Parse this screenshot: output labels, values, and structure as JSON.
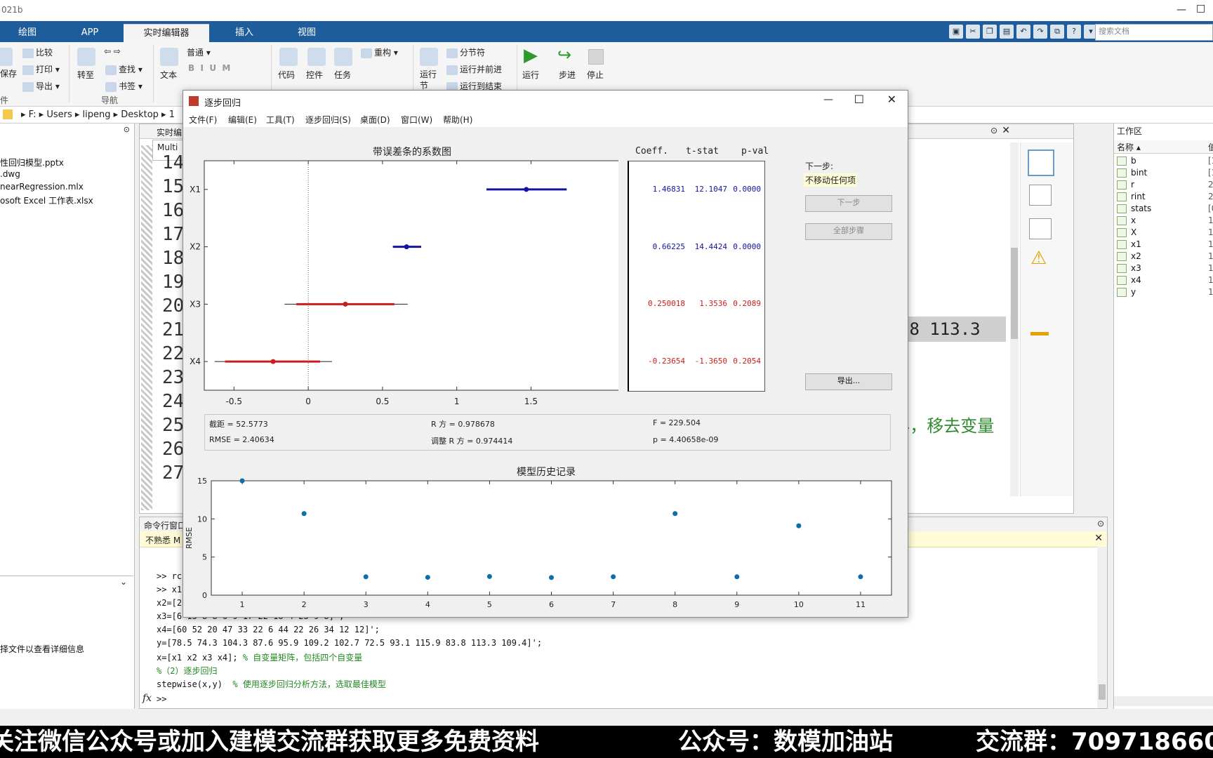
{
  "app": {
    "title": "021b"
  },
  "tabs": [
    {
      "label": "绘图"
    },
    {
      "label": "APP"
    },
    {
      "label": "实时编辑器"
    },
    {
      "label": "插入"
    },
    {
      "label": "视图"
    }
  ],
  "search": {
    "placeholder": "搜索文档"
  },
  "ribbon": {
    "save": "保存",
    "compare": "比较",
    "print": "打印",
    "export": "导出",
    "file_section": "件",
    "goto": "转至",
    "find": "查找",
    "bookmark": "书签",
    "nav_section": "导航",
    "text": "文本",
    "normal": "普通",
    "code": "代码",
    "control": "控件",
    "task": "任务",
    "refactor": "重构",
    "section_break": "分节符",
    "run_and_advance": "运行并前进",
    "run_to_end": "运行到结束",
    "run_section": "运行节",
    "run": "运行",
    "step": "步进",
    "stop": "停止"
  },
  "address": {
    "parts": [
      "F:",
      "Users",
      "lipeng",
      "Desktop",
      "1"
    ]
  },
  "leftpane": {
    "files": [
      "性回归模型.pptx",
      ".dwg",
      "nearRegression.mlx",
      "osoft Excel 工作表.xlsx"
    ],
    "detail_hint": "择文件以查看详细信息"
  },
  "editor": {
    "tab_label": "实时编",
    "doc_tab": "Multi",
    "line_numbers": [
      "14",
      "15",
      "16",
      "17",
      "18",
      "19",
      "20",
      "21",
      "22",
      "23",
      "24",
      "25",
      "26",
      "27"
    ],
    "visible_data": ".8 113.3",
    "visible_comment": "4，移去变量"
  },
  "cmdwin": {
    "title": "命令行窗口",
    "notice": "不熟悉 M",
    "lines": [
      ">> rc",
      ">> x1",
      "x2=[2",
      "x3=[6 15 8 8 6 9 17 22 18 4 23 9 8]';",
      "x4=[60 52 20 47 33 22 6 44 22 26 34 12 12]';",
      "y=[78.5 74.3 104.3 87.6 95.9 109.2 102.7 72.5 93.1 115.9 83.8 113.3 109.4]';"
    ],
    "line7_code": "x=[x1 x2 x3 x4]; ",
    "line7_comment": "% 自变量矩阵，包括四个自变量",
    "line8_comment": "%（2）逐步回归",
    "line9_code": "stepwise(x,y)  ",
    "line9_comment": "% 使用逐步回归分析方法，选取最佳模型",
    "prompt": ">>",
    "fx": "fx"
  },
  "workspace": {
    "title": "工作区",
    "col_name": "名称",
    "col_value": "值",
    "vars": [
      {
        "name": "b",
        "val": "[1"
      },
      {
        "name": "bint",
        "val": "[1"
      },
      {
        "name": "r",
        "val": "2"
      },
      {
        "name": "rint",
        "val": "2"
      },
      {
        "name": "stats",
        "val": "[0"
      },
      {
        "name": "x",
        "val": "1"
      },
      {
        "name": "X",
        "val": "1"
      },
      {
        "name": "x1",
        "val": "1"
      },
      {
        "name": "x2",
        "val": "1"
      },
      {
        "name": "x3",
        "val": "1"
      },
      {
        "name": "x4",
        "val": "1"
      },
      {
        "name": "y",
        "val": "1"
      }
    ]
  },
  "dialog": {
    "title": "逐步回归",
    "menus": [
      "文件(F)",
      "编辑(E)",
      "工具(T)",
      "逐步回归(S)",
      "桌面(D)",
      "窗口(W)",
      "帮助(H)"
    ],
    "next_step_label": "下一步:",
    "next_step_value": "不移动任何项",
    "btn_next": "下一步",
    "btn_all": "全部步骤",
    "btn_export": "导出...",
    "coef_header": [
      "Coeff.",
      "t-stat",
      "p-val"
    ],
    "rows": [
      {
        "coef": "1.46831",
        "t": "12.1047",
        "p": "0.0000",
        "color": "#1414a0"
      },
      {
        "coef": "0.66225",
        "t": "14.4424",
        "p": "0.0000",
        "color": "#1414a0"
      },
      {
        "coef": "0.250018",
        "t": "1.3536",
        "p": "0.2089",
        "color": "#c81e1e"
      },
      {
        "coef": "-0.23654",
        "t": "-1.3650",
        "p": "0.2054",
        "color": "#c81e1e"
      }
    ],
    "stats": {
      "intercept": "截距 = 52.5773",
      "rsq": "R 方 = 0.978678",
      "f": "F = 229.504",
      "rmse": "RMSE = 2.40634",
      "adj_rsq": "调整 R 方 = 0.974414",
      "p": "p = 4.40658e-09"
    }
  },
  "chart_data": [
    {
      "type": "scatter",
      "title": "带误差条的系数图",
      "categories": [
        "X1",
        "X2",
        "X3",
        "X4"
      ],
      "xlim": [
        -0.7,
        2.15
      ],
      "xticks": [
        -0.5,
        0,
        0.5,
        1,
        1.5
      ],
      "points": [
        {
          "name": "X1",
          "value": 1.46831,
          "ci_inner": [
            1.2,
            1.74
          ],
          "ci_outer": [
            1.2,
            1.74
          ],
          "color": "#1414a0"
        },
        {
          "name": "X2",
          "value": 0.66225,
          "ci_inner": [
            0.57,
            0.76
          ],
          "ci_outer": [
            0.57,
            0.76
          ],
          "color": "#1414a0"
        },
        {
          "name": "X3",
          "value": 0.250018,
          "ci_inner": [
            -0.08,
            0.58
          ],
          "ci_outer": [
            -0.16,
            0.67
          ],
          "color": "#c81e1e"
        },
        {
          "name": "X4",
          "value": -0.23654,
          "ci_inner": [
            -0.56,
            0.08
          ],
          "ci_outer": [
            -0.63,
            0.16
          ],
          "color": "#c81e1e"
        }
      ]
    },
    {
      "type": "scatter",
      "title": "模型历史记录",
      "ylabel": "RMSE",
      "x": [
        1,
        2,
        3,
        4,
        5,
        6,
        7,
        8,
        9,
        10,
        11
      ],
      "y": [
        15.0,
        10.7,
        2.41,
        2.34,
        2.45,
        2.31,
        2.41,
        10.7,
        2.41,
        9.1,
        2.41
      ],
      "xlim": [
        0.5,
        11.5
      ],
      "ylim": [
        0,
        15
      ],
      "yticks": [
        0,
        5,
        10,
        15
      ],
      "color": "#0e6ea8"
    }
  ],
  "banner": {
    "part1": "关注微信公众号或加入建模交流群获取更多免费资料",
    "part2": "公众号：数模加油站",
    "part3": "交流群：709718660"
  }
}
